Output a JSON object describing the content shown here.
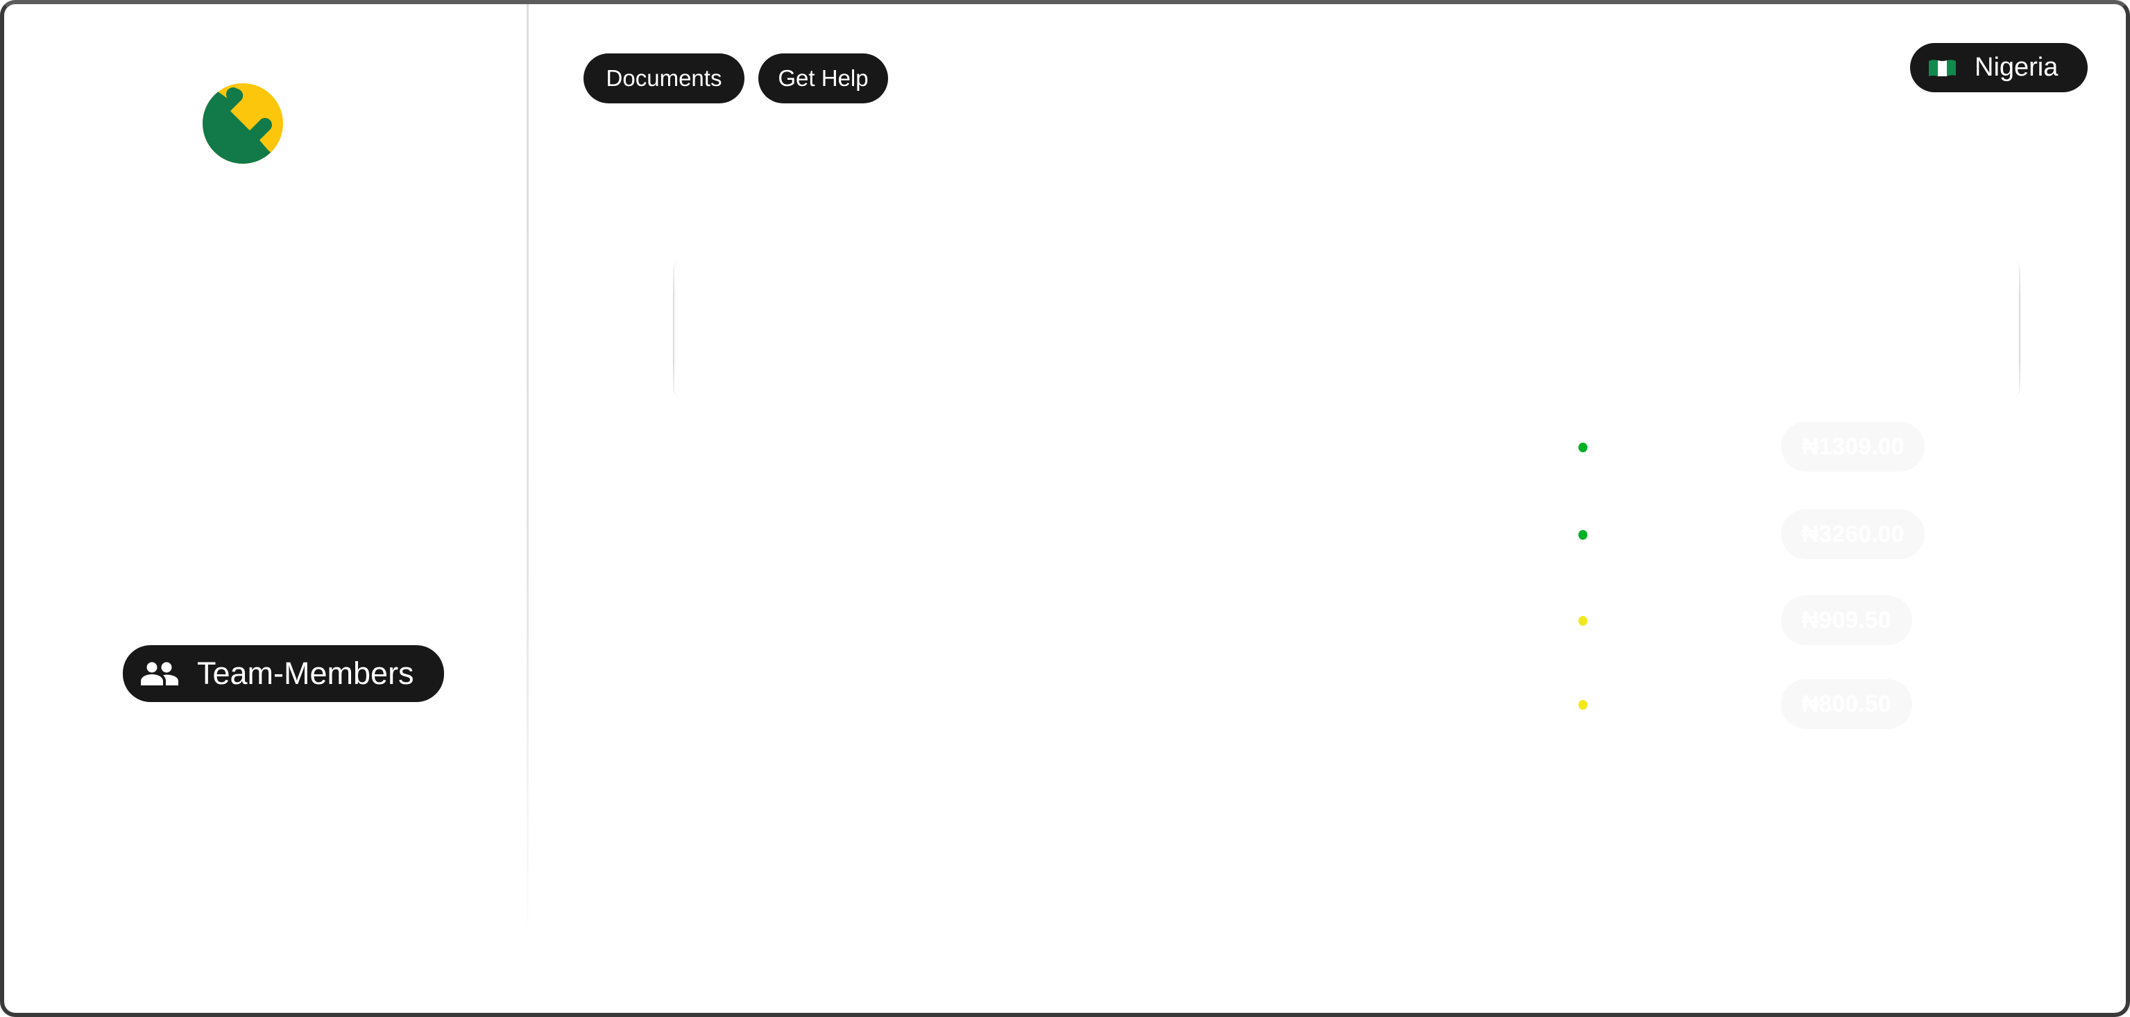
{
  "brand": {
    "logo_icon": "brand-logo-icon",
    "colors": {
      "green": "#127a48",
      "yellow": "#fcc60c"
    }
  },
  "sidebar": {
    "team_members_label": "Team-Members",
    "team_members_icon": "people-icon"
  },
  "header": {
    "documents_label": "Documents",
    "get_help_label": "Get Help",
    "country": {
      "label": "Nigeria",
      "flag_icon": "nigeria-flag-icon"
    }
  },
  "transactions": [
    {
      "status": "success",
      "status_color": "#00b024",
      "amount": "₦1309.00"
    },
    {
      "status": "success",
      "status_color": "#00b024",
      "amount": "₦3260.00"
    },
    {
      "status": "pending",
      "status_color": "#f2e81e",
      "amount": "₦909.50"
    },
    {
      "status": "pending",
      "status_color": "#f2e81e",
      "amount": "₦800.50"
    }
  ]
}
